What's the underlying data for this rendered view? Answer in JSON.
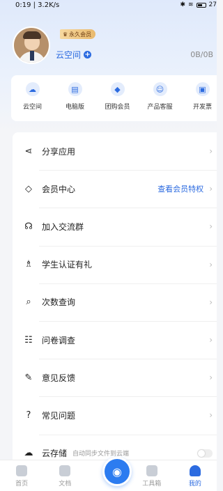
{
  "status": {
    "time_speed": "0:19 | 3.2K/s",
    "battery": "27"
  },
  "profile": {
    "vip_badge": "永久会员",
    "cloud_name": "云空间",
    "storage": "0B/0B"
  },
  "quick": [
    {
      "label": "云空间",
      "icon": "cloud-upload-icon",
      "glyph": "☁"
    },
    {
      "label": "电脑版",
      "icon": "computer-icon",
      "glyph": "▤"
    },
    {
      "label": "团购会员",
      "icon": "diamond-icon",
      "glyph": "◆"
    },
    {
      "label": "产品客服",
      "icon": "chat-icon",
      "glyph": "☺"
    },
    {
      "label": "开发票",
      "icon": "invoice-icon",
      "glyph": "▣"
    }
  ],
  "menu": [
    {
      "label": "分享应用",
      "icon": "share-icon",
      "glyph": "⋖"
    },
    {
      "label": "会员中心",
      "icon": "diamond-outline-icon",
      "glyph": "◇",
      "link": "查看会员特权"
    },
    {
      "label": "加入交流群",
      "icon": "group-icon",
      "glyph": "☊"
    },
    {
      "label": "学生认证有礼",
      "icon": "graduation-cap-icon",
      "glyph": "♗"
    },
    {
      "label": "次数查询",
      "icon": "query-icon",
      "glyph": "⌕"
    },
    {
      "label": "问卷调查",
      "icon": "survey-icon",
      "glyph": "☷"
    },
    {
      "label": "意见反馈",
      "icon": "feedback-icon",
      "glyph": "✎"
    },
    {
      "label": "常见问题",
      "icon": "faq-icon",
      "glyph": "?"
    },
    {
      "label": "云存储",
      "icon": "cloud-storage-icon",
      "glyph": "☁",
      "sub": "自动同步文件到云端"
    }
  ],
  "tabs": [
    {
      "label": "首页"
    },
    {
      "label": "文档"
    },
    {
      "label": ""
    },
    {
      "label": "工具箱"
    },
    {
      "label": "我的"
    }
  ]
}
